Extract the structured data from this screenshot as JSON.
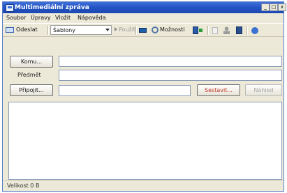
{
  "window": {
    "title": "Multimediální zpráva",
    "controls": [
      "_",
      "□",
      "x"
    ]
  },
  "menu": [
    "Soubor",
    "Úpravy",
    "Vložit",
    "Nápověda"
  ],
  "toolbar": {
    "send": "Odeslat",
    "templates": "Šablony",
    "use": "Použít",
    "options": "Možnosti"
  },
  "form": {
    "to_button": "Komu...",
    "subject_label": "Předmět",
    "attach_button": "Připojit...",
    "compose_button": "Sestavit...",
    "preview_button": "Náhled",
    "to_value": "",
    "subject_value": "",
    "attach_value": "",
    "message_value": ""
  },
  "status": {
    "text": "Velikost 0 B"
  },
  "colors": {
    "titlebar": "#2556c6",
    "compose_text": "#c0392b",
    "chrome": "#ece9d8"
  }
}
